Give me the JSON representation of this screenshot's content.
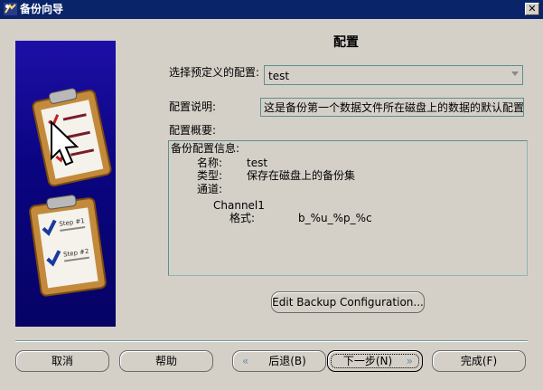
{
  "window": {
    "title": "备份向导",
    "close_glyph": "✕"
  },
  "page": {
    "heading": "配置"
  },
  "form": {
    "predefined_label": "选择预定义的配置:",
    "predefined_value": "test",
    "description_label": "配置说明:",
    "description_value": "这是备份第一个数据文件所在磁盘上的数据的默认配置",
    "summary_label": "配置概要:"
  },
  "summary": {
    "header": "备份配置信息:",
    "name_key": "名称:",
    "name_value": "test",
    "type_key": "类型:",
    "type_value": "保存在磁盘上的备份集",
    "channel_key": "通道:",
    "channel_name": "Channel1",
    "format_key": "格式:",
    "format_value": "b_%u_%p_%c"
  },
  "buttons": {
    "edit": "Edit Backup Configuration...",
    "cancel": "取消",
    "help": "帮助",
    "back": "后退(B)",
    "next": "下一步(N)",
    "finish": "完成(F)"
  },
  "illustration": {
    "step1": "Step #1",
    "step2": "Step #2"
  },
  "icons": {
    "back": "chevron-left-double-icon",
    "next": "chevron-right-double-icon",
    "close": "close-icon",
    "app": "wizard-app-icon"
  }
}
